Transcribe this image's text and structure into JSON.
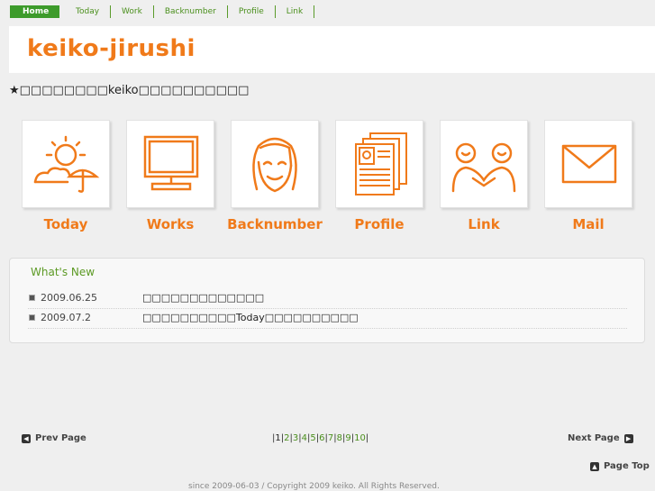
{
  "nav": {
    "items": [
      {
        "label": "Home"
      },
      {
        "label": "Today"
      },
      {
        "label": "Work"
      },
      {
        "label": "Backnumber"
      },
      {
        "label": "Profile"
      },
      {
        "label": "Link"
      }
    ]
  },
  "header": {
    "logo": "keiko-jirushi"
  },
  "tagline": "★□□□□□□□□keiko□□□□□□□□□□",
  "icons": [
    {
      "label": "Today",
      "icon": "sun-umbrella-icon"
    },
    {
      "label": "Works",
      "icon": "monitor-icon"
    },
    {
      "label": "Backnumber",
      "icon": "face-icon"
    },
    {
      "label": "Profile",
      "icon": "profile-document-icon"
    },
    {
      "label": "Link",
      "icon": "people-handshake-icon"
    },
    {
      "label": "Mail",
      "icon": "envelope-icon"
    }
  ],
  "news": {
    "title": "What's New",
    "items": [
      {
        "date": "2009.06.25",
        "text": "□□□□□□□□□□□□□"
      },
      {
        "date": "2009.07.2",
        "text": "□□□□□□□□□□Today□□□□□□□□□□"
      }
    ]
  },
  "pager": {
    "prev": "Prev Page",
    "next": "Next Page",
    "pages": [
      "1",
      "2",
      "3",
      "4",
      "5",
      "6",
      "7",
      "8",
      "9",
      "10"
    ],
    "page_top": "Page Top"
  },
  "footer": "since 2009-06-03  / Copyright 2009 keiko. All Rights Reserved.",
  "colors": {
    "accent": "#f07a1a",
    "nav_green": "#3d9b2b"
  }
}
